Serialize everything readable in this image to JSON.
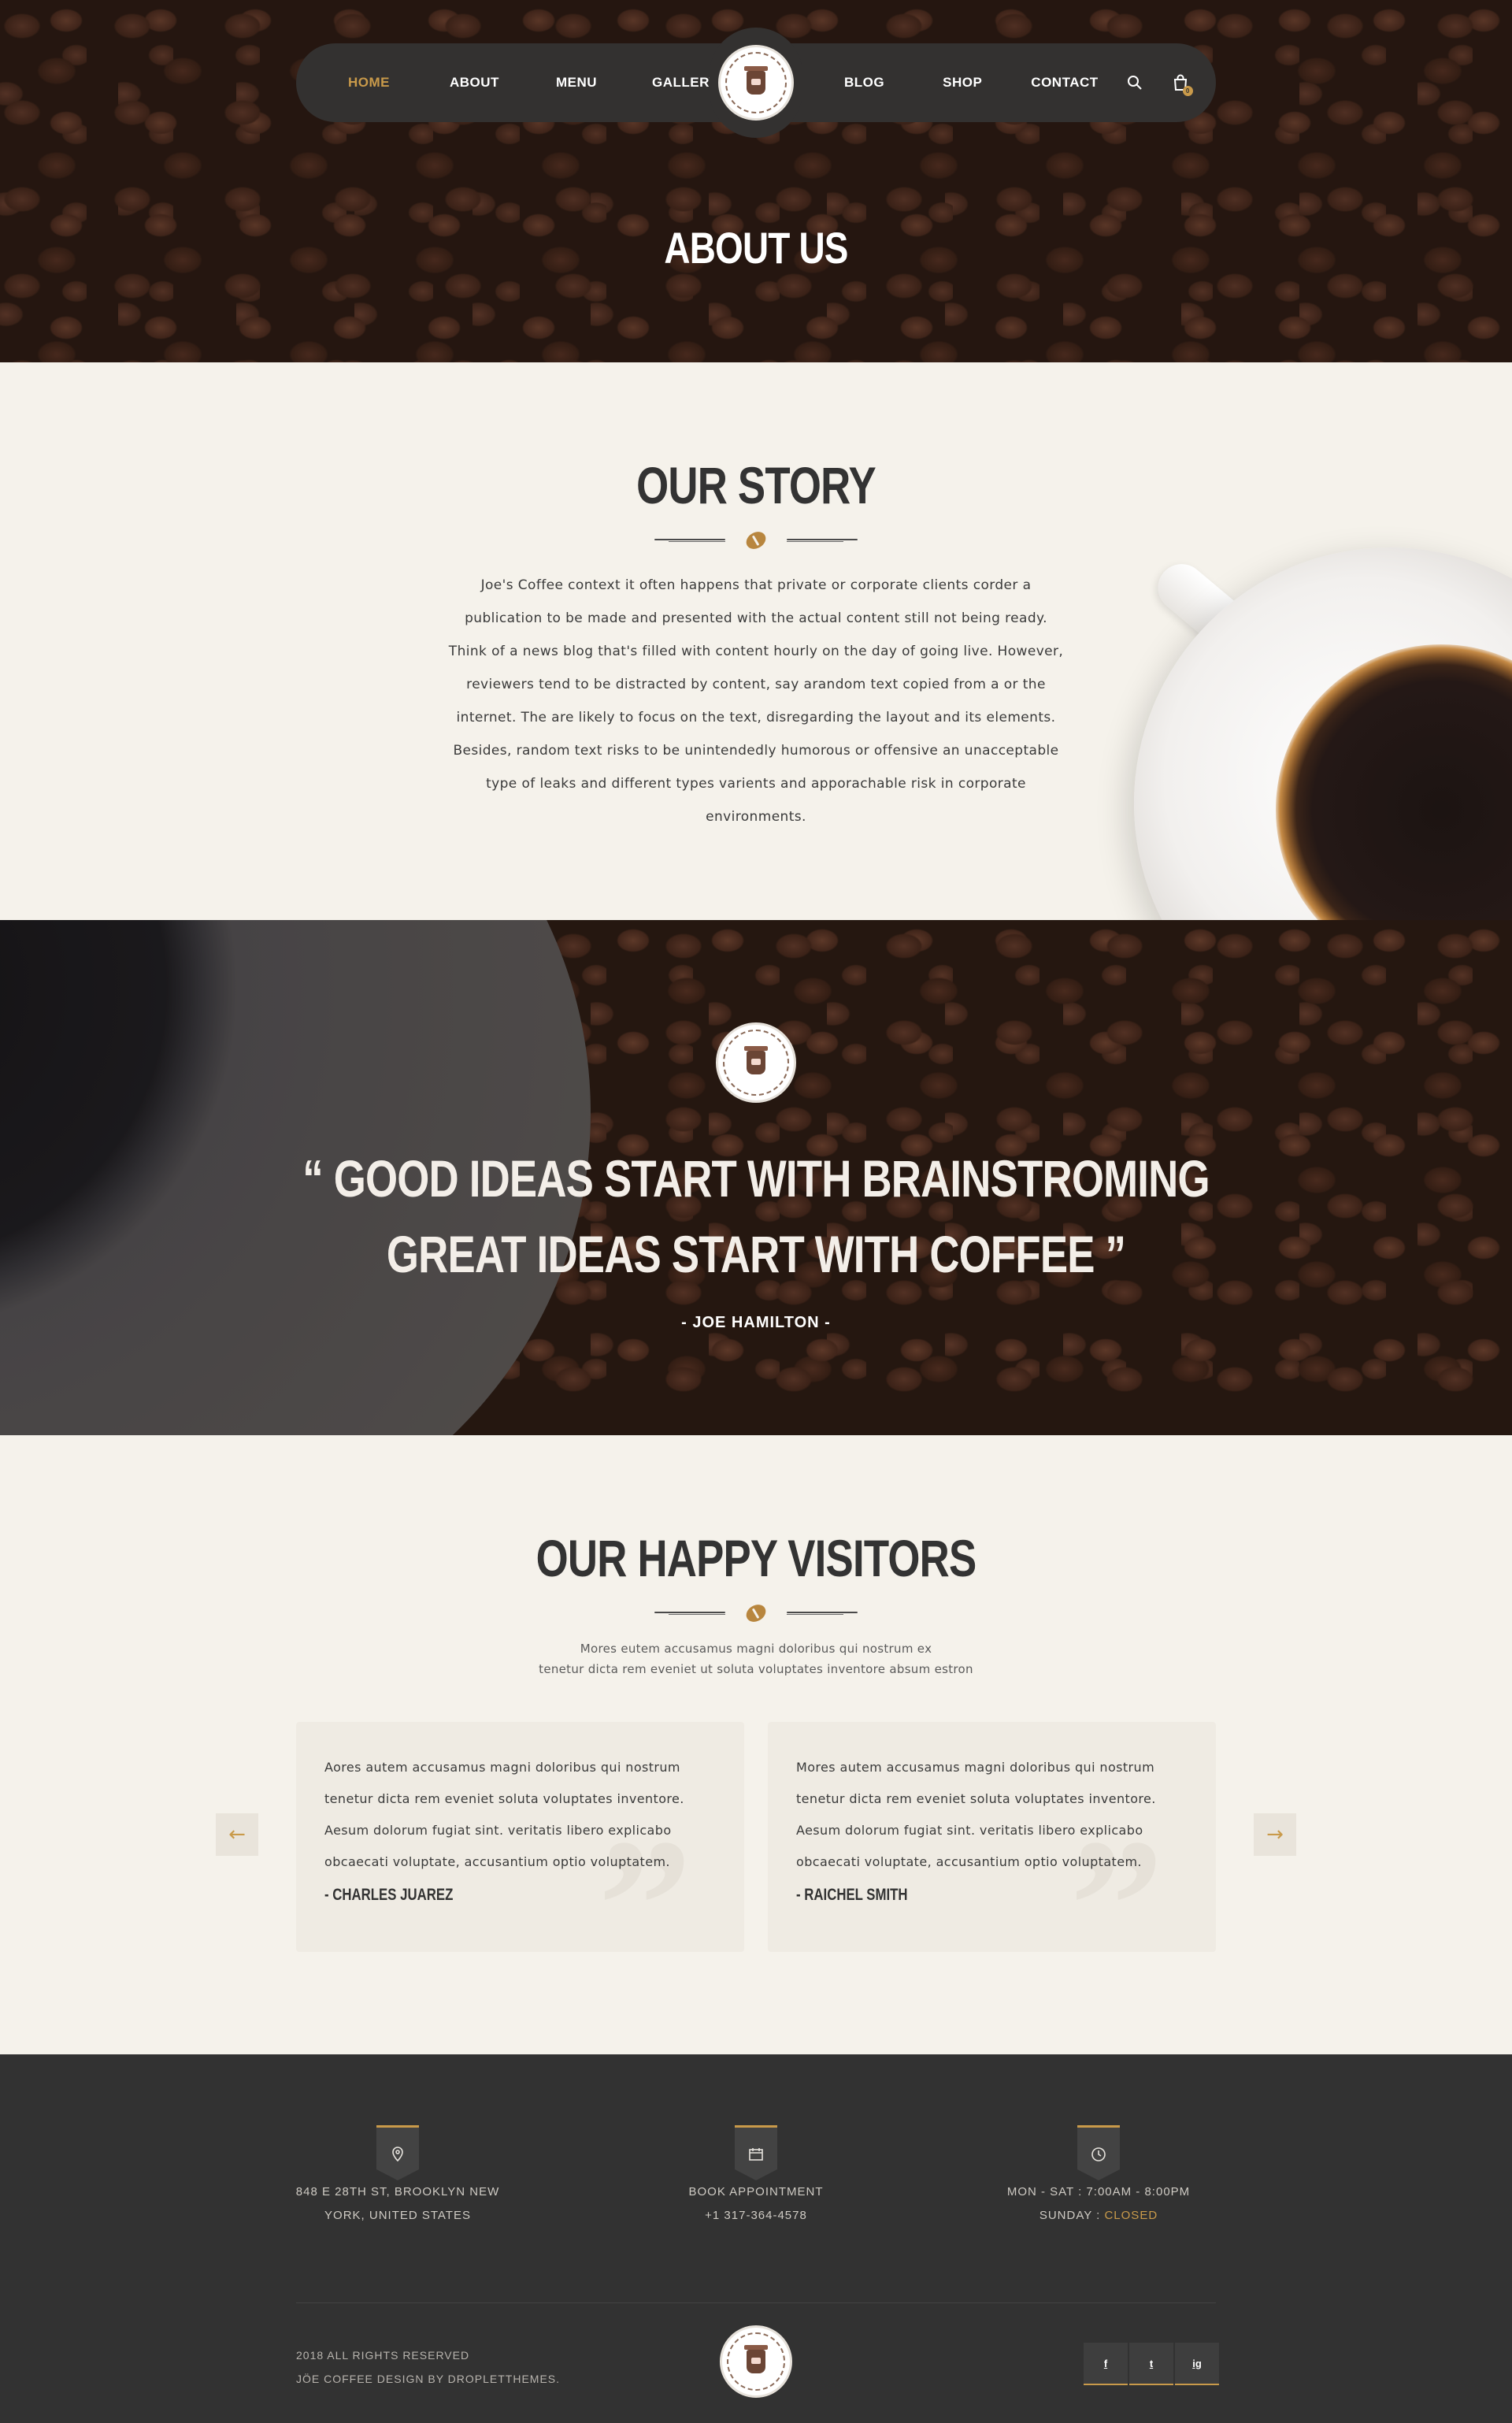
{
  "nav": {
    "left": [
      {
        "label": "HOME",
        "active": true
      },
      {
        "label": "ABOUT"
      },
      {
        "label": "MENU"
      },
      {
        "label": "GALLERY"
      }
    ],
    "right": [
      {
        "label": "BLOG"
      },
      {
        "label": "SHOP"
      },
      {
        "label": "CONTACT"
      }
    ],
    "cart_count": "0",
    "icons": [
      "search-icon",
      "cart-icon"
    ]
  },
  "hero": {
    "title": "ABOUT US"
  },
  "story": {
    "title": "OUR STORY",
    "text": "Joe's Coffee context it often happens that private or corporate clients corder a publication to be made and presented with the actual content still not being ready. Think of a news blog that's filled with content hourly on the day of going live. However, reviewers tend to be distracted by content, say arandom text copied from a or the internet. The are likely to focus on the text, disregarding the layout and its elements. Besides, random text risks to be unintendedly humorous or offensive an unacceptable type of leaks and different types varients and apporachable risk in corporate environments."
  },
  "quote": {
    "line1": "“ GOOD IDEAS START WITH BRAINSTROMING",
    "line2": "GREAT IDEAS START WITH COFFEE ”",
    "author": "- JOE HAMILTON -"
  },
  "visitors": {
    "title": "OUR HAPPY VISITORS",
    "subtitle_1": "Mores eutem accusamus magni doloribus qui nostrum ex",
    "subtitle_2": "tenetur dicta rem eveniet ut soluta voluptates inventore absum estron",
    "cards": [
      {
        "text": "Aores autem accusamus magni doloribus qui nostrum tenetur dicta rem eveniet soluta voluptates inventore. Aesum dolorum fugiat sint. veritatis libero explicabo obcaecati voluptate, accusantium optio voluptatem.",
        "name": "- CHARLES JUAREZ"
      },
      {
        "text": "Mores autem accusamus magni doloribus qui nostrum tenetur dicta rem eveniet soluta voluptates inventore. Aesum dolorum fugiat sint. veritatis libero explicabo obcaecati voluptate, accusantium optio voluptatem.",
        "name": "- RAICHEL SMITH"
      }
    ],
    "prev_arrow": "←",
    "next_arrow": "→"
  },
  "footer": {
    "address_1": "848 E 28TH ST, BROOKLYN NEW",
    "address_2": "YORK, UNITED STATES",
    "appointment_1": "BOOK APPOINTMENT",
    "appointment_2": "+1 317-364-4578",
    "hours_1": "MON - SAT : 7:00AM - 8:00PM",
    "hours_2_prefix": "SUNDAY : ",
    "hours_2_status": "CLOSED",
    "copyright_1": "2018 ALL RIGHTS RESERVED",
    "copyright_2": "JÖE COFFEE DESIGN BY DROPLETTHEMES.",
    "social": [
      "f",
      "t",
      "ig"
    ],
    "icons": [
      "location-icon",
      "calendar-icon",
      "clock-icon"
    ]
  },
  "colors": {
    "accent": "#c99a4a",
    "dark": "#333130",
    "background": "#f5f2eb",
    "footer": "#323232"
  }
}
